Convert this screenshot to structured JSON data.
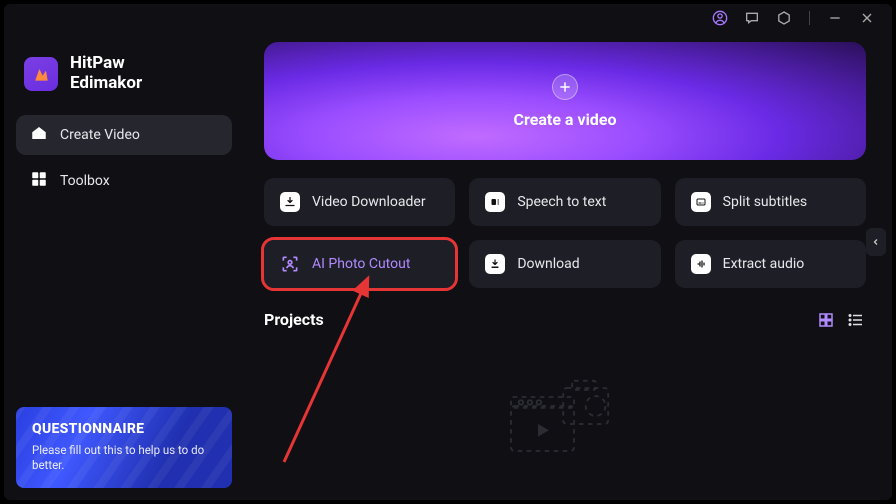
{
  "app": {
    "name_line1": "HitPaw",
    "name_line2": "Edimakor"
  },
  "sidebar": {
    "items": [
      {
        "label": "Create Video",
        "icon": "home-icon",
        "active": true
      },
      {
        "label": "Toolbox",
        "icon": "toolbox-icon",
        "active": false
      }
    ]
  },
  "promo": {
    "title": "QUESTIONNAIRE",
    "subtitle": "Please fill out this to help us to do better."
  },
  "hero": {
    "label": "Create a video"
  },
  "tools": [
    {
      "label": "Video Downloader",
      "icon": "download-media-icon"
    },
    {
      "label": "Speech to text",
      "icon": "speech-to-text-icon"
    },
    {
      "label": "Split subtitles",
      "icon": "split-subtitles-icon"
    },
    {
      "label": "AI Photo Cutout",
      "icon": "ai-cutout-icon",
      "highlighted": true
    },
    {
      "label": "Download",
      "icon": "download-icon"
    },
    {
      "label": "Extract audio",
      "icon": "extract-audio-icon"
    }
  ],
  "projects": {
    "title": "Projects"
  },
  "annotation": {
    "highlight_tool_index": 3,
    "has_arrow": true
  }
}
